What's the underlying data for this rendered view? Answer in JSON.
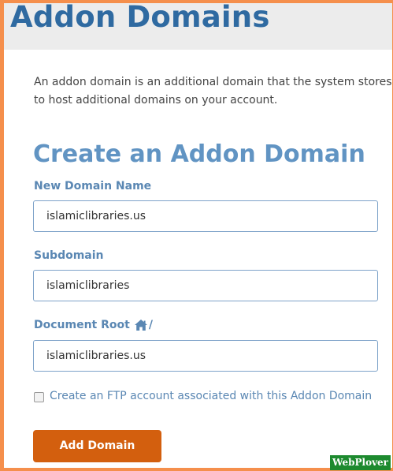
{
  "page": {
    "title": "Addon Domains",
    "description_line1": "An addon domain is an additional domain that the system stores",
    "description_line2": "to host additional domains on your account."
  },
  "form": {
    "section_title": "Create an Addon Domain",
    "new_domain": {
      "label": "New Domain Name",
      "value": "islamiclibraries.us"
    },
    "subdomain": {
      "label": "Subdomain",
      "value": "islamiclibraries"
    },
    "document_root": {
      "label": "Document Root",
      "icon": "home-icon",
      "separator": "/",
      "value": "islamiclibraries.us"
    },
    "ftp_checkbox": {
      "label": "Create an FTP account associated with this Addon Domain",
      "checked": false
    },
    "submit_label": "Add Domain"
  },
  "watermark": "WebPlover",
  "colors": {
    "border_orange": "#f58f4c",
    "title_blue": "#2f6aa1",
    "section_blue": "#6194c3",
    "label_blue": "#5a87b3",
    "button_orange": "#d35f0e",
    "watermark_green": "#1d8a2f"
  }
}
